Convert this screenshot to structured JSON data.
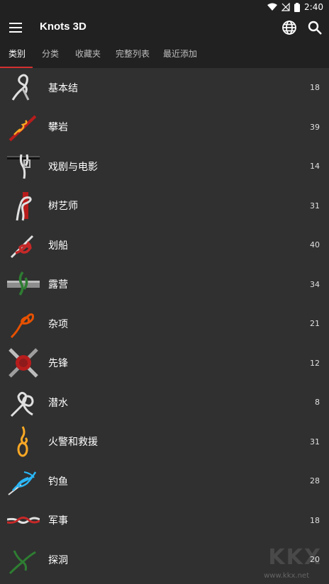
{
  "status_bar": {
    "time": "2:40"
  },
  "app_bar": {
    "title": "Knots 3D"
  },
  "tabs": [
    {
      "label": "类别"
    },
    {
      "label": "分类"
    },
    {
      "label": "收藏夹"
    },
    {
      "label": "完整列表"
    },
    {
      "label": "最近添加"
    }
  ],
  "categories": [
    {
      "label": "基本结",
      "count": "18",
      "icon": "basic-knot-icon",
      "color": "#e0e0e0"
    },
    {
      "label": "攀岩",
      "count": "39",
      "icon": "climbing-knot-icon",
      "color": "#f5a623"
    },
    {
      "label": "戏剧与电影",
      "count": "14",
      "icon": "theatre-knot-icon",
      "color": "#ffffff"
    },
    {
      "label": "树艺师",
      "count": "31",
      "icon": "arborist-knot-icon",
      "color": "#b71c1c"
    },
    {
      "label": "划船",
      "count": "40",
      "icon": "boating-knot-icon",
      "color": "#c62828"
    },
    {
      "label": "露营",
      "count": "34",
      "icon": "camping-knot-icon",
      "color": "#2e7d32"
    },
    {
      "label": "杂项",
      "count": "21",
      "icon": "misc-knot-icon",
      "color": "#e65100"
    },
    {
      "label": "先锋",
      "count": "12",
      "icon": "pioneering-knot-icon",
      "color": "#c62828"
    },
    {
      "label": "潜水",
      "count": "8",
      "icon": "diving-knot-icon",
      "color": "#e0e0e0"
    },
    {
      "label": "火警和救援",
      "count": "31",
      "icon": "rescue-knot-icon",
      "color": "#f9a825"
    },
    {
      "label": "钓鱼",
      "count": "28",
      "icon": "fishing-knot-icon",
      "color": "#29b6f6"
    },
    {
      "label": "军事",
      "count": "18",
      "icon": "military-knot-icon",
      "color": "#c62828"
    },
    {
      "label": "探洞",
      "count": "20",
      "icon": "caving-knot-icon",
      "color": "#2e7d32"
    }
  ],
  "colors": {
    "background": "#303030",
    "bar": "#212121",
    "accent": "#d32f2f"
  },
  "watermark": {
    "text": "KKX",
    "url": "www.kkx.net"
  }
}
